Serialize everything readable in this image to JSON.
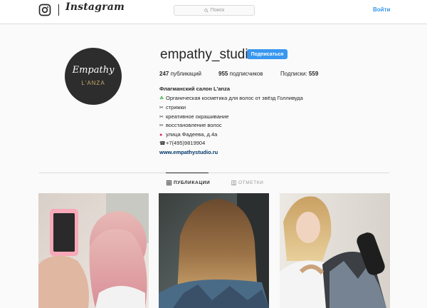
{
  "header": {
    "brand": "Instagram",
    "search_placeholder": "Поиск",
    "login_label": "Войти"
  },
  "profile": {
    "username": "empathy_studio",
    "follow_label": "Подписаться",
    "avatar": {
      "script": "Empathy",
      "brand": "L'ANZA"
    },
    "stats": {
      "posts_count": "247",
      "posts_label": "публикаций",
      "followers_count": "955",
      "followers_label": "подписчиков",
      "following_label": "Подписки:",
      "following_count": "559"
    },
    "bio_title": "Флагманский салон L'anza",
    "bio_lines": [
      {
        "icon": "clover-icon",
        "text": "Органическая косметика для волос от звёзд Голливуда"
      },
      {
        "icon": "scissors-icon",
        "text": "стрижки"
      },
      {
        "icon": "scissors-icon",
        "text": "креативное окрашивание"
      },
      {
        "icon": "scissors-icon",
        "text": "восстановление волос"
      },
      {
        "icon": "pin-icon",
        "text": "улица Фадеева, д.4а"
      },
      {
        "icon": "phone-icon",
        "text": "+7(495)9819904"
      }
    ],
    "website": "www.empathystudio.ru"
  },
  "tabs": [
    {
      "label": "ПУБЛИКАЦИИ",
      "active": true,
      "icon": "grid-icon"
    },
    {
      "label": "ОТМЕТКИ",
      "active": false,
      "icon": "tag-icon"
    }
  ],
  "posts": [
    {
      "description_icon": "photo-pink-hair"
    },
    {
      "description_icon": "photo-brown-hair"
    },
    {
      "description_icon": "photo-stylist-dryer"
    }
  ],
  "colors": {
    "accent": "#3897f0",
    "link": "#003569",
    "border": "#dbdbdb"
  }
}
